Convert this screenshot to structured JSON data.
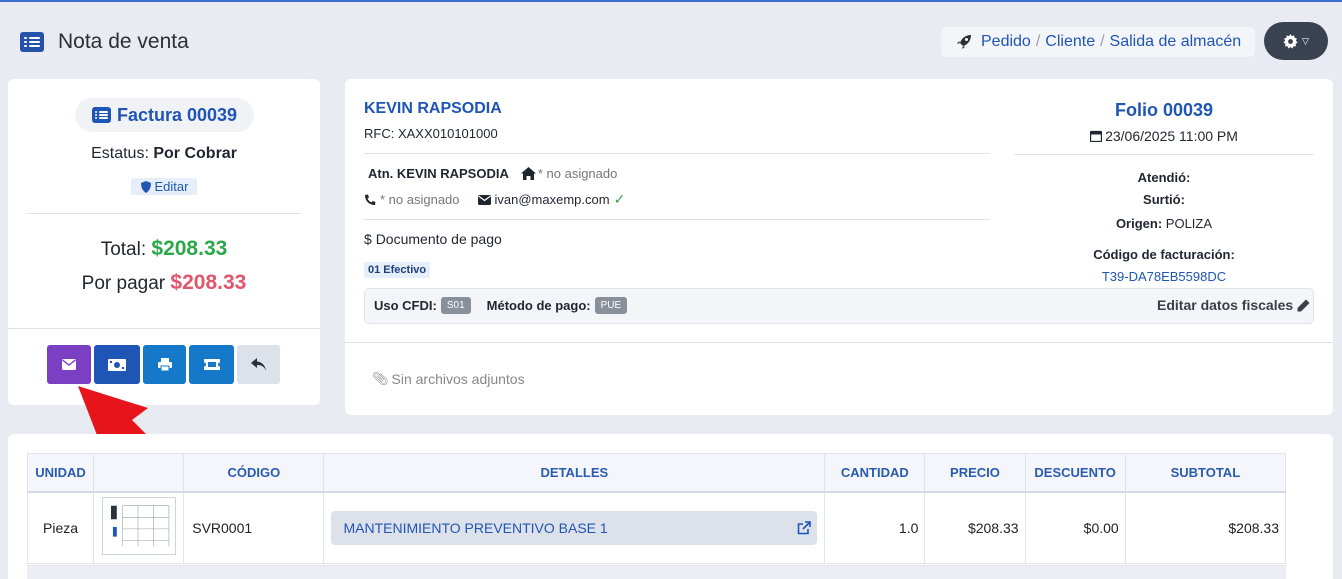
{
  "header": {
    "title": "Nota de venta"
  },
  "breadcrumb": {
    "items": [
      "Pedido",
      "Cliente",
      "Salida de almacén"
    ],
    "sep": "/"
  },
  "invoice": {
    "label": "Factura 00039",
    "status_label": "Estatus:",
    "status_value": "Por Cobrar",
    "edit_label": "Editar",
    "total_label": "Total:",
    "total_value": "$208.33",
    "due_label": "Por pagar",
    "due_value": "$208.33"
  },
  "client": {
    "name": "KEVIN RAPSODIA",
    "rfc": "RFC: XAXX010101000",
    "attn": "Atn. KEVIN RAPSODIA",
    "address": "* no asignado",
    "phone": "* no asignado",
    "email": "ivan@maxemp.com",
    "payment_doc_label": "Documento de pago",
    "payment_method_badge": "01 Efectivo",
    "cfdi_label": "Uso CFDI:",
    "cfdi_value": "S01",
    "metodo_label": "Método de pago:",
    "metodo_value": "PUE",
    "edit_fiscal": "Editar datos fiscales",
    "attachments": "Sin archivos adjuntos"
  },
  "folio": {
    "title": "Folio 00039",
    "date": "23/06/2025 11:00 PM",
    "atendio_label": "Atendió:",
    "surtio_label": "Surtió:",
    "origen_label": "Origen:",
    "origen_value": "POLIZA",
    "codigo_label": "Código de facturación:",
    "codigo_value": "T39-DA78EB5598DC"
  },
  "table": {
    "headers": [
      "UNIDAD",
      "",
      "CÓDIGO",
      "DETALLES",
      "CANTIDAD",
      "PRECIO",
      "DESCUENTO",
      "SUBTOTAL"
    ],
    "rows": [
      {
        "unidad": "Pieza",
        "codigo": "SVR0001",
        "detalles": "MANTENIMIENTO PREVENTIVO BASE 1",
        "cantidad": "1.0",
        "precio": "$208.33",
        "descuento": "$0.00",
        "subtotal": "$208.33"
      }
    ]
  },
  "colors": {
    "accent": "#1f55b4",
    "green": "#2aa84a",
    "red": "#e0566b",
    "purple": "#7b3fc4",
    "blue": "#1f55b4",
    "arrow": "#e8141c"
  }
}
